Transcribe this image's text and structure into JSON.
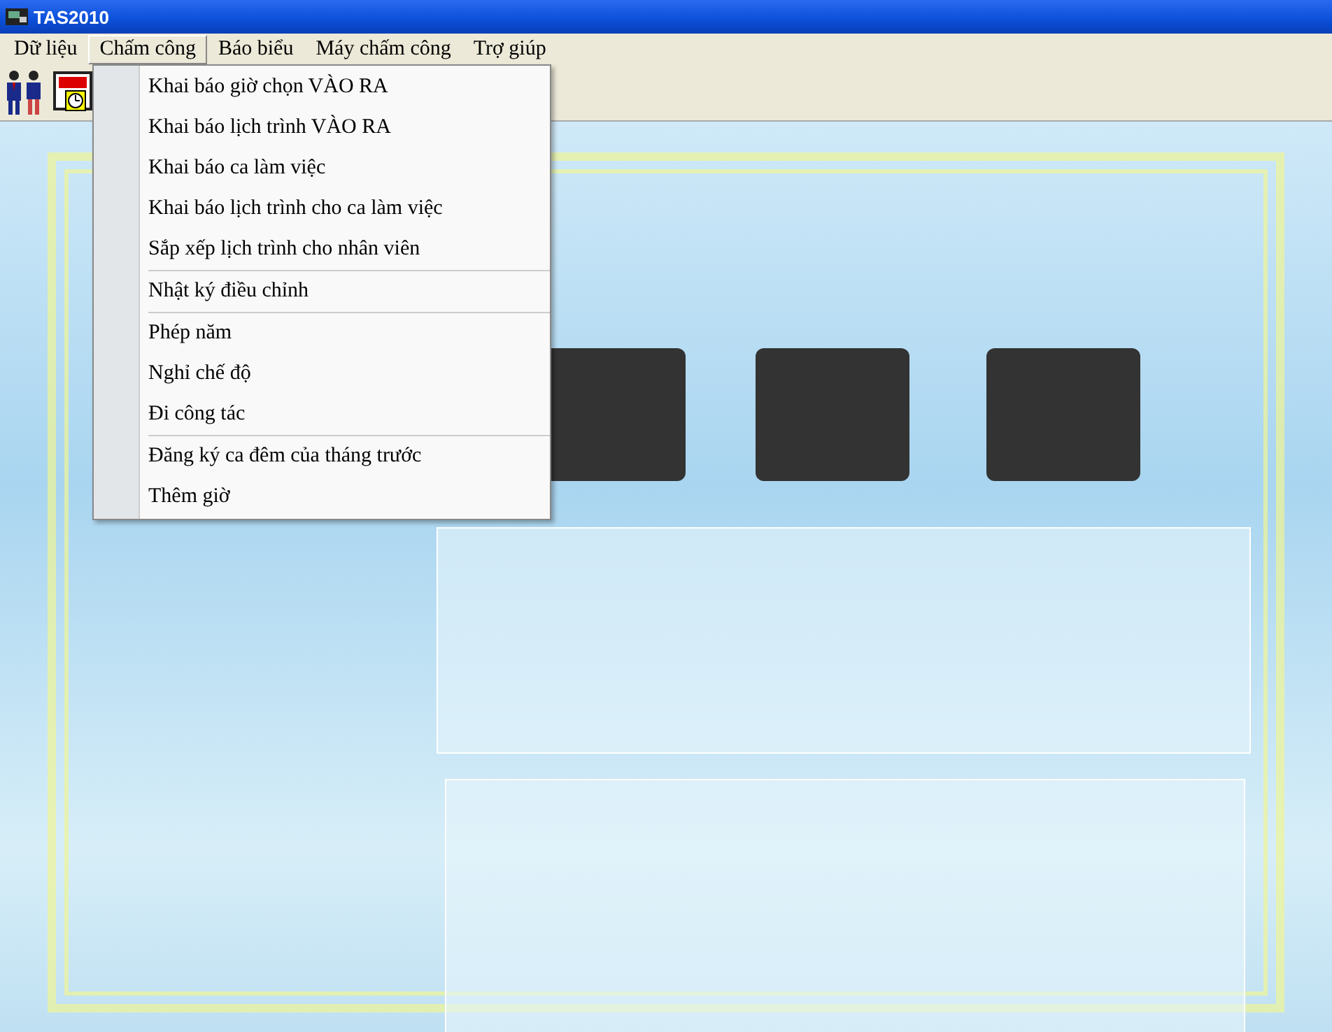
{
  "window": {
    "title": "TAS2010"
  },
  "menu_bar": [
    {
      "label": "Dữ liệu",
      "selected": false
    },
    {
      "label": "Chấm công",
      "selected": true
    },
    {
      "label": "Báo biểu",
      "selected": false
    },
    {
      "label": "Máy chấm công",
      "selected": false
    },
    {
      "label": "Trợ giúp",
      "selected": false
    }
  ],
  "dropdown_menu": {
    "groups": [
      [
        "Khai báo giờ chọn VÀO RA",
        "Khai báo lịch trình VÀO RA",
        "Khai báo ca làm việc",
        "Khai báo lịch trình cho ca làm việc",
        "Sắp xếp lịch trình cho nhân viên"
      ],
      [
        "Nhật ký điều chỉnh"
      ],
      [
        "Phép năm",
        "Nghỉ chế độ",
        "Đi công tác"
      ],
      [
        "Đăng ký ca đêm của tháng trước",
        "Thêm giờ"
      ]
    ]
  }
}
